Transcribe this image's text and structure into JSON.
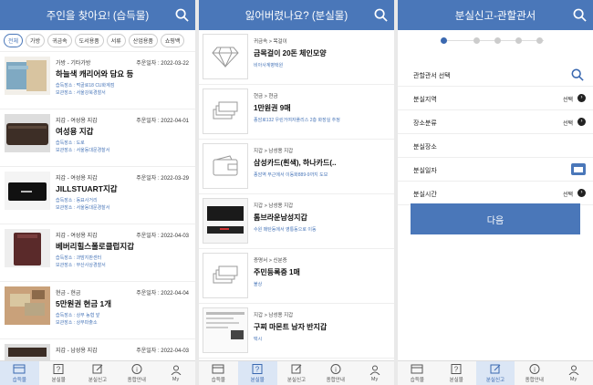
{
  "screens": {
    "found": {
      "title": "주인을 찾아요! (습득물)",
      "chips": [
        "전체",
        "가방",
        "귀금속",
        "도서용품",
        "서류",
        "산업용품",
        "쇼핑백"
      ],
      "items": [
        {
          "category": "가방 - 기타가방",
          "date": "주운일자 : 2022-03-22",
          "title": "하늘색 캐리어와 담요 등",
          "place": "습득장소 : 먹골로18 CU화계점",
          "storage": "보관장소 : 서울강북경찰서",
          "thumb": "bag"
        },
        {
          "category": "지갑 - 여성용 지갑",
          "date": "주운일자 : 2022-04-01",
          "title": "여성용 지갑",
          "place": "습득장소 : 도로",
          "storage": "보관장소 : 서울동대문경찰서",
          "thumb": "wallet-dark"
        },
        {
          "category": "지갑 - 여성용 지갑",
          "date": "주운일자 : 2022-03-29",
          "title": "JILLSTUART지갑",
          "place": "습득장소 : 동묘사거리",
          "storage": "보관장소 : 서울동대문경찰서",
          "thumb": "wallet-black"
        },
        {
          "category": "지갑 - 여성용 지갑",
          "date": "주운일자 : 2022-04-03",
          "title": "베버리힐스폴로클럽지갑",
          "place": "습득장소 : 과밤지판센터",
          "storage": "보관장소 : 부산사상경찰서",
          "thumb": "wallet-brown"
        },
        {
          "category": "현금 - 현금",
          "date": "주운일자 : 2022-04-04",
          "title": "5만원권 현금 1개",
          "place": "습득장소 : 상무 농협 앞",
          "storage": "보관장소 : 상무파출소",
          "thumb": "cash"
        },
        {
          "category": "지갑 - 남성용 지갑",
          "date": "주운일자 : 2022-04-03",
          "title": "",
          "place": "",
          "storage": "",
          "thumb": "wallet-dark"
        }
      ]
    },
    "lost": {
      "title": "잃어버렸나요? (분실물)",
      "items": [
        {
          "category": "귀금속 > 목걸이",
          "title": "금목걸이 20돈 체인모양",
          "location": "비아사계병택원",
          "thumb": "diamond"
        },
        {
          "category": "현금 > 현금",
          "title": "1만원권 9매",
          "location": "종암로132 우린거여자플리스 2층 화장실 추정",
          "thumb": "money"
        },
        {
          "category": "지갑 > 남성용 지갑",
          "title": "삼성카드(흰색), 하나카드(..",
          "location": "종암역 부근에서 이동화889-9까지 도보",
          "thumb": "wallet"
        },
        {
          "category": "지갑 > 남성용 지갑",
          "title": "톰브라운남성지갑",
          "location": "수원 매탄동에서 영통동으로 이동",
          "thumb": "wallet-photo"
        },
        {
          "category": "증명서 > 신분증",
          "title": "주민등록증 1매",
          "location": "불상",
          "thumb": "money"
        },
        {
          "category": "지갑 > 남성용 지갑",
          "title": "구찌 마몬트 남자 반지갑",
          "location": "택시",
          "thumb": "screenshot"
        }
      ]
    },
    "report": {
      "title": "분실신고-관할관서",
      "rows": [
        {
          "label": "관할관서 선택",
          "action": "",
          "control": "search"
        },
        {
          "label": "분실지역",
          "action": "선택",
          "control": "arrow"
        },
        {
          "label": "장소분류",
          "action": "선택",
          "control": "arrow"
        },
        {
          "label": "분실장소",
          "action": "",
          "control": "none"
        },
        {
          "label": "분실일자",
          "action": "",
          "control": "calendar"
        },
        {
          "label": "분실시간",
          "action": "선택",
          "control": "arrow"
        }
      ],
      "next_label": "다음"
    }
  },
  "tabbar": [
    "습득물",
    "분실물",
    "분실신고",
    "종합안내",
    "My"
  ],
  "colors": {
    "accent": "#4a77b9",
    "active_tab_bg": "#dbe6f5"
  }
}
